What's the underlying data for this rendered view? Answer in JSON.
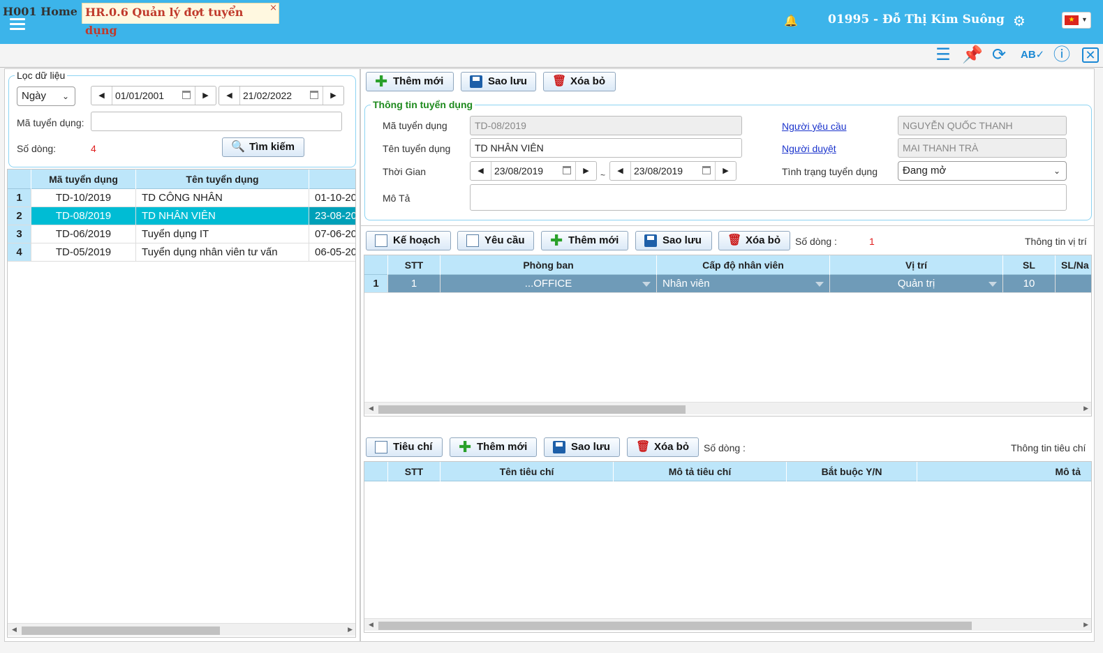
{
  "header": {
    "user": "01995 - Đỗ Thị Kim Suông",
    "icons": [
      "menu-icon",
      "bell-icon",
      "gear-icon",
      "vietnam-flag-icon"
    ]
  },
  "tabs": {
    "home": "H001 Home",
    "active": "HR.0.6 Quản lý đợt tuyển dụng",
    "close": "×"
  },
  "toolbar_icons": [
    "list-icon",
    "pin-icon",
    "refresh-icon",
    "spellcheck-icon",
    "help-icon",
    "close-box-icon"
  ],
  "filter": {
    "legend": "Lọc dữ liệu",
    "mode": "Ngày",
    "from": "01/01/2001",
    "to": "21/02/2022",
    "code_label": "Mã tuyển dụng:",
    "code_value": "",
    "rows_label": "Số dòng:",
    "rows_value": "4",
    "search_button": "Tìm kiếm"
  },
  "list_grid": {
    "columns": [
      "Mã tuyển dụng",
      "Tên tuyển dụng",
      ""
    ],
    "rows": [
      {
        "n": "1",
        "code": "TD-10/2019",
        "name": "TD CÔNG NHÂN",
        "date": "01-10-20"
      },
      {
        "n": "2",
        "code": "TD-08/2019",
        "name": "TD NHÂN VIÊN",
        "date": "23-08-20"
      },
      {
        "n": "3",
        "code": "TD-06/2019",
        "name": "Tuyển dụng IT",
        "date": "07-06-20"
      },
      {
        "n": "4",
        "code": "TD-05/2019",
        "name": "Tuyển dụng nhân viên tư vấn",
        "date": "06-05-20"
      }
    ]
  },
  "main_toolbar": {
    "add": "Thêm mới",
    "save": "Sao lưu",
    "delete": "Xóa bỏ"
  },
  "info": {
    "legend": "Thông tin tuyển dụng",
    "code_label": "Mã tuyển dụng",
    "code_value": "TD-08/2019",
    "name_label": "Tên tuyển dụng",
    "name_value": "TD NHÂN VIÊN",
    "time_label": "Thời Gian",
    "time_from": "23/08/2019",
    "time_sep": "~",
    "time_to": "23/08/2019",
    "desc_label": "Mô Tả",
    "desc_value": "",
    "requester_label": "Người yêu cầu",
    "requester_value": "NGUYỄN QUỐC THANH",
    "approver_label": "Người duyệt",
    "approver_value": "MAI THANH TRÀ",
    "status_label": "Tình trạng tuyển dụng",
    "status_value": "Đang mở"
  },
  "position_toolbar": {
    "plan": "Kế hoạch",
    "request": "Yêu cầu",
    "add": "Thêm mới",
    "save": "Sao lưu",
    "delete": "Xóa bỏ",
    "rows_label": "Số dòng :",
    "rows_value": "1",
    "right_title": "Thông tin vị trí"
  },
  "position_grid": {
    "columns": [
      "STT",
      "Phòng ban",
      "Cấp độ nhân viên",
      "Vị trí",
      "SL",
      "SL/Na"
    ],
    "rows": [
      {
        "n": "1",
        "stt": "1",
        "dept": "...OFFICE",
        "level": "Nhân viên",
        "position": "Quản trị",
        "qty": "10",
        "extra": ""
      }
    ]
  },
  "criteria_toolbar": {
    "criteria": "Tiêu chí",
    "add": "Thêm mới",
    "save": "Sao lưu",
    "delete": "Xóa bỏ",
    "rows_label": "Số dòng :",
    "right_title": "Thông tin tiêu chí"
  },
  "criteria_grid": {
    "columns": [
      "STT",
      "Tên tiêu chí",
      "Mô tả tiêu chí",
      "Bắt buộc Y/N",
      "Mô tả"
    ]
  }
}
